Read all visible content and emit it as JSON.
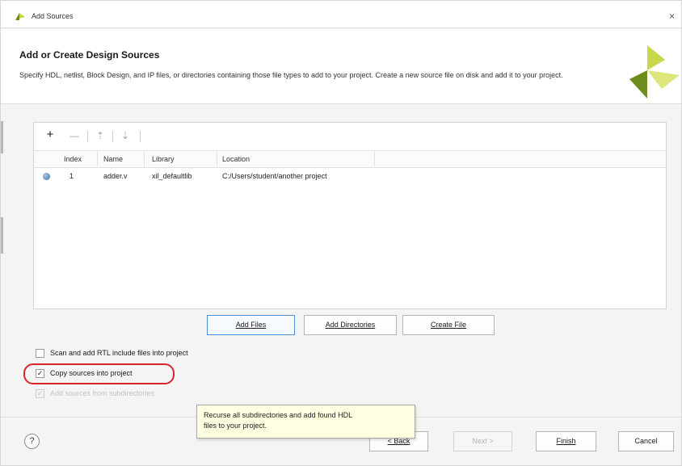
{
  "window": {
    "title": "Add Sources",
    "close_glyph": "×"
  },
  "header": {
    "title": "Add or Create Design Sources",
    "description": "Specify HDL, netlist, Block Design, and IP files, or directories containing those file types to add to your project. Create a new source file on disk and add it to your project."
  },
  "toolbar": {
    "add_glyph": "+",
    "remove_glyph": "—",
    "up_glyph": "⇡",
    "down_glyph": "⇣",
    "icons": [
      "plus-icon",
      "minus-icon",
      "arrow-up-icon",
      "arrow-down-icon"
    ]
  },
  "table": {
    "columns": [
      "Index",
      "Name",
      "Library",
      "Location"
    ],
    "rows": [
      {
        "index": "1",
        "name": "adder.v",
        "library": "xil_defaultlib",
        "location": "C:/Users/student/another project"
      }
    ]
  },
  "buttons": {
    "add_files": "Add Files",
    "add_directories": "Add Directories",
    "create_file": "Create File"
  },
  "options": {
    "scan_rtl": {
      "label": "Scan and add RTL include files into project",
      "checked": false
    },
    "copy_sources": {
      "label": "Copy sources into project",
      "checked": true
    },
    "add_subdirs": {
      "label": "Add sources from subdirectories",
      "checked": true,
      "disabled": true
    }
  },
  "tooltip": {
    "line1": "Recurse all subdirectories and add found HDL",
    "line2": "files to your project."
  },
  "footer": {
    "help_glyph": "?",
    "back": "< Back",
    "next": "Next >",
    "finish": "Finish",
    "cancel": "Cancel"
  },
  "colors": {
    "logo_light": "#c9d84a",
    "logo_dark": "#6f8c1f",
    "highlight": "#d9242b",
    "primary_border": "#4b8fd8",
    "tooltip_bg": "#ffffe1"
  }
}
